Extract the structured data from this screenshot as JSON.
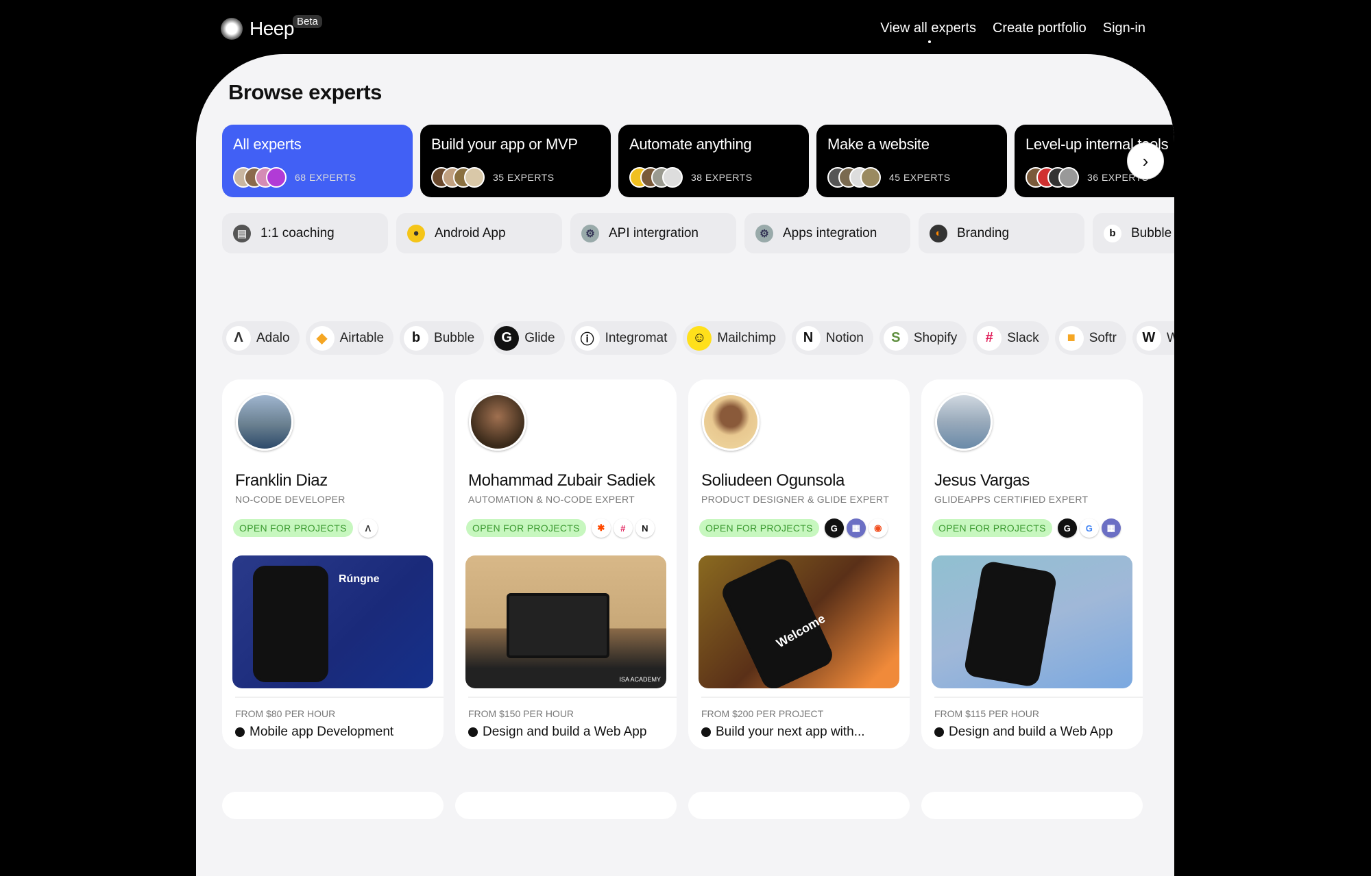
{
  "header": {
    "logo": "Heep",
    "beta": "Beta",
    "nav": [
      {
        "label": "View all experts",
        "active": true
      },
      {
        "label": "Create portfolio"
      },
      {
        "label": "Sign-in"
      }
    ]
  },
  "page_title": "Browse experts",
  "categories": [
    {
      "label": "All experts",
      "count": "68 EXPERTS",
      "active": true
    },
    {
      "label": "Build your app or MVP",
      "count": "35 EXPERTS"
    },
    {
      "label": "Automate anything",
      "count": "38 EXPERTS"
    },
    {
      "label": "Make a website",
      "count": "45 EXPERTS"
    },
    {
      "label": "Level-up internal tools",
      "count": "36 EXPERTS"
    }
  ],
  "tags": [
    {
      "label": "1:1 coaching",
      "icon": "cabinet-icon"
    },
    {
      "label": "Android App",
      "icon": "chick-icon"
    },
    {
      "label": "API intergration",
      "icon": "gear-icon"
    },
    {
      "label": "Apps integration",
      "icon": "gear-icon"
    },
    {
      "label": "Branding",
      "icon": "penguin-icon"
    },
    {
      "label": "Bubble",
      "icon": "bubble-icon"
    }
  ],
  "tools": [
    "Adalo",
    "Airtable",
    "Bubble",
    "Glide",
    "Integromat",
    "Mailchimp",
    "Notion",
    "Shopify",
    "Slack",
    "Softr",
    "Webflow"
  ],
  "experts": [
    {
      "name": "Franklin Diaz",
      "role": "NO-CODE DEVELOPER",
      "status": "OPEN FOR PROJECTS",
      "tools": [
        "adalo"
      ],
      "price": "FROM $80 PER HOUR",
      "project": "Mobile app Development",
      "shot_text": "Rúngne"
    },
    {
      "name": "Mohammad Zubair Sadiek",
      "role": "AUTOMATION & NO-CODE EXPERT",
      "status": "OPEN FOR PROJECTS",
      "tools": [
        "zapier",
        "slack",
        "notion"
      ],
      "price": "FROM $150 PER HOUR",
      "project": "Design and build a Web App",
      "shot_text": "ISA ACADEMY"
    },
    {
      "name": "Soliudeen Ogunsola",
      "role": "PRODUCT DESIGNER & GLIDE EXPERT",
      "status": "OPEN FOR PROJECTS",
      "tools": [
        "glide",
        "book",
        "figma"
      ],
      "price": "FROM $200 PER PROJECT",
      "project": "Build your next app with...",
      "shot_text": "Welcome"
    },
    {
      "name": "Jesus Vargas",
      "role": "GLIDEAPPS CERTIFIED EXPERT",
      "status": "OPEN FOR PROJECTS",
      "tools": [
        "glide",
        "google",
        "book"
      ],
      "price": "FROM $115 PER HOUR",
      "project": "Design and build a Web App",
      "shot_text": ""
    }
  ],
  "colors": {
    "accent": "#4160f5",
    "open_bg": "#c7f7bf",
    "open_text": "#3a9a2f",
    "panel": "#f4f4f6"
  }
}
